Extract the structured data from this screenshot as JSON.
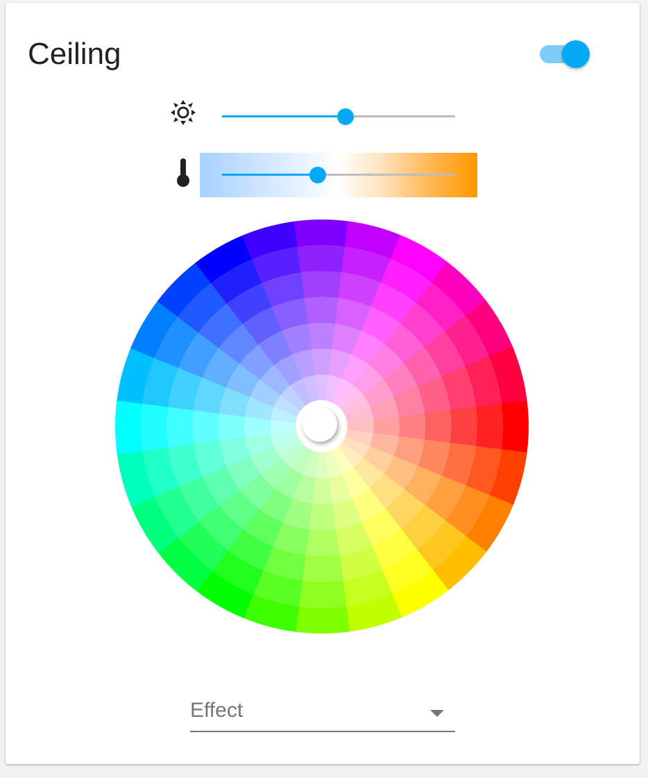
{
  "card": {
    "title": "Ceiling",
    "power_on": true
  },
  "brightness": {
    "icon": "brightness-icon",
    "value_fraction": 0.53
  },
  "color_temp": {
    "icon": "thermometer-icon",
    "value_fraction": 0.41
  },
  "color_wheel": {
    "selected_hue_deg": 0,
    "selected_saturation": 0
  },
  "effect": {
    "label": "Effect",
    "icon": "dropdown-arrow-icon"
  },
  "colors": {
    "accent": "#03a9f4",
    "toggle_track": "#7ecbf8",
    "rail": "#bdbdbd"
  }
}
